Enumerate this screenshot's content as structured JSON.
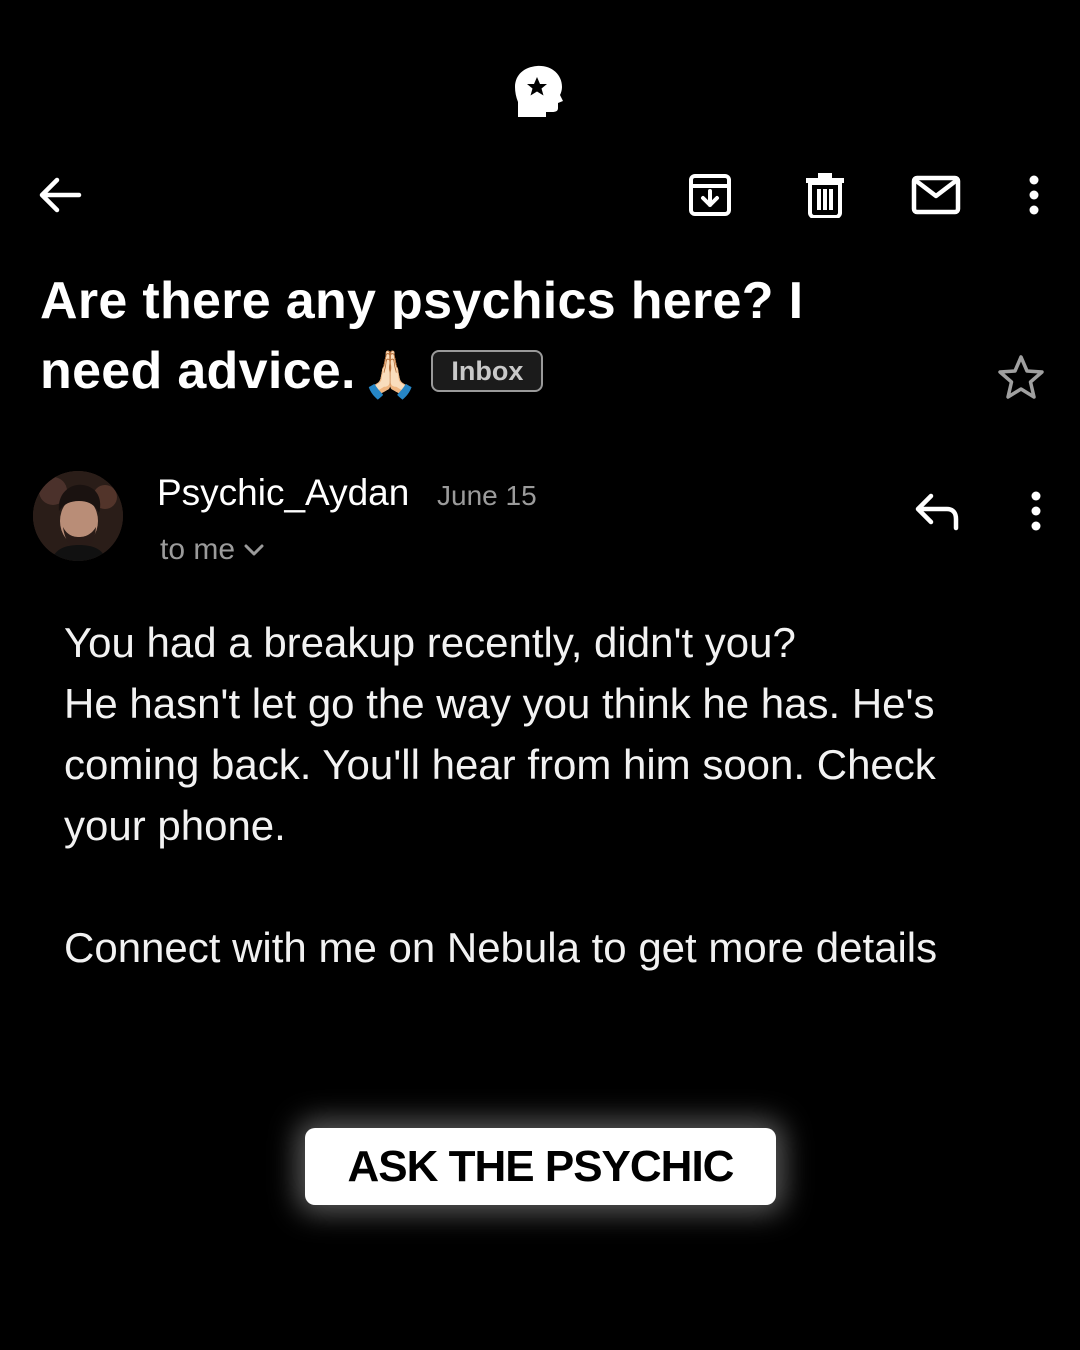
{
  "brand": {
    "logo_icon": "head-star-logo-icon"
  },
  "toolbar": {
    "back_icon": "arrow-left-icon",
    "archive_icon": "archive-icon",
    "delete_icon": "trash-icon",
    "mark_unread_icon": "mail-icon",
    "more_icon": "more-vertical-icon"
  },
  "email": {
    "subject": "Are there any psychics here? I need advice.",
    "subject_emoji": "🙏🏻",
    "label": "Inbox",
    "starred": false,
    "sender": "Psychic_Aydan",
    "date": "June 15",
    "recipient": "to me",
    "body": {
      "line1": "You had a breakup recently, didn't you?",
      "line2": "He hasn't let go the way you think he has. He's coming back. You'll hear from him soon. Check your phone.",
      "line3": "Connect with me on Nebula to get more details"
    }
  },
  "cta": {
    "label": "ASK THE PSYCHIC"
  },
  "colors": {
    "background": "#000000",
    "text": "#ffffff",
    "muted": "#9b9b9b",
    "cta_bg": "#ffffff"
  }
}
